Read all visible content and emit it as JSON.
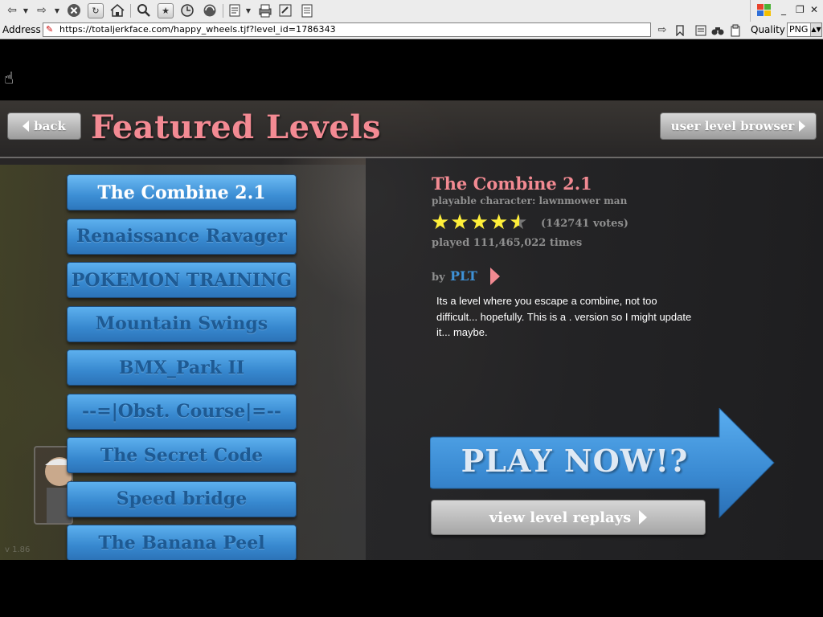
{
  "browser": {
    "address_label": "Address",
    "url": "https://totaljerkface.com/happy_wheels.tjf?level_id=1786343",
    "quality_label": "Quality",
    "format_value": "PNG"
  },
  "game": {
    "back_label": "back",
    "title": "Featured Levels",
    "user_browser_label": "user level browser",
    "levels": [
      "The Combine 2.1",
      "Renaissance Ravager",
      "POKEMON TRAINING",
      "Mountain Swings",
      "BMX_Park II",
      "--=|Obst. Course|=--",
      "The Secret Code",
      "Speed bridge",
      "The Banana Peel"
    ],
    "selected": {
      "title": "The Combine 2.1",
      "character": "playable character: lawnmower man",
      "rating": 4.5,
      "votes": "(142741 votes)",
      "played": "played 111,465,022 times",
      "by_label": "by",
      "author": "PLT",
      "description": "Its a level where you escape a combine, not too difficult... hopefully. This is a . version so I might update it... maybe."
    },
    "play_label": "PLAY NOW!?",
    "replays_label": "view level replays",
    "version": "v 1.86"
  },
  "colors": {
    "title_pink": "#f38a93",
    "button_blue": "#3788cf",
    "author_blue": "#3e92d8",
    "star_yellow": "#ffef3a"
  }
}
